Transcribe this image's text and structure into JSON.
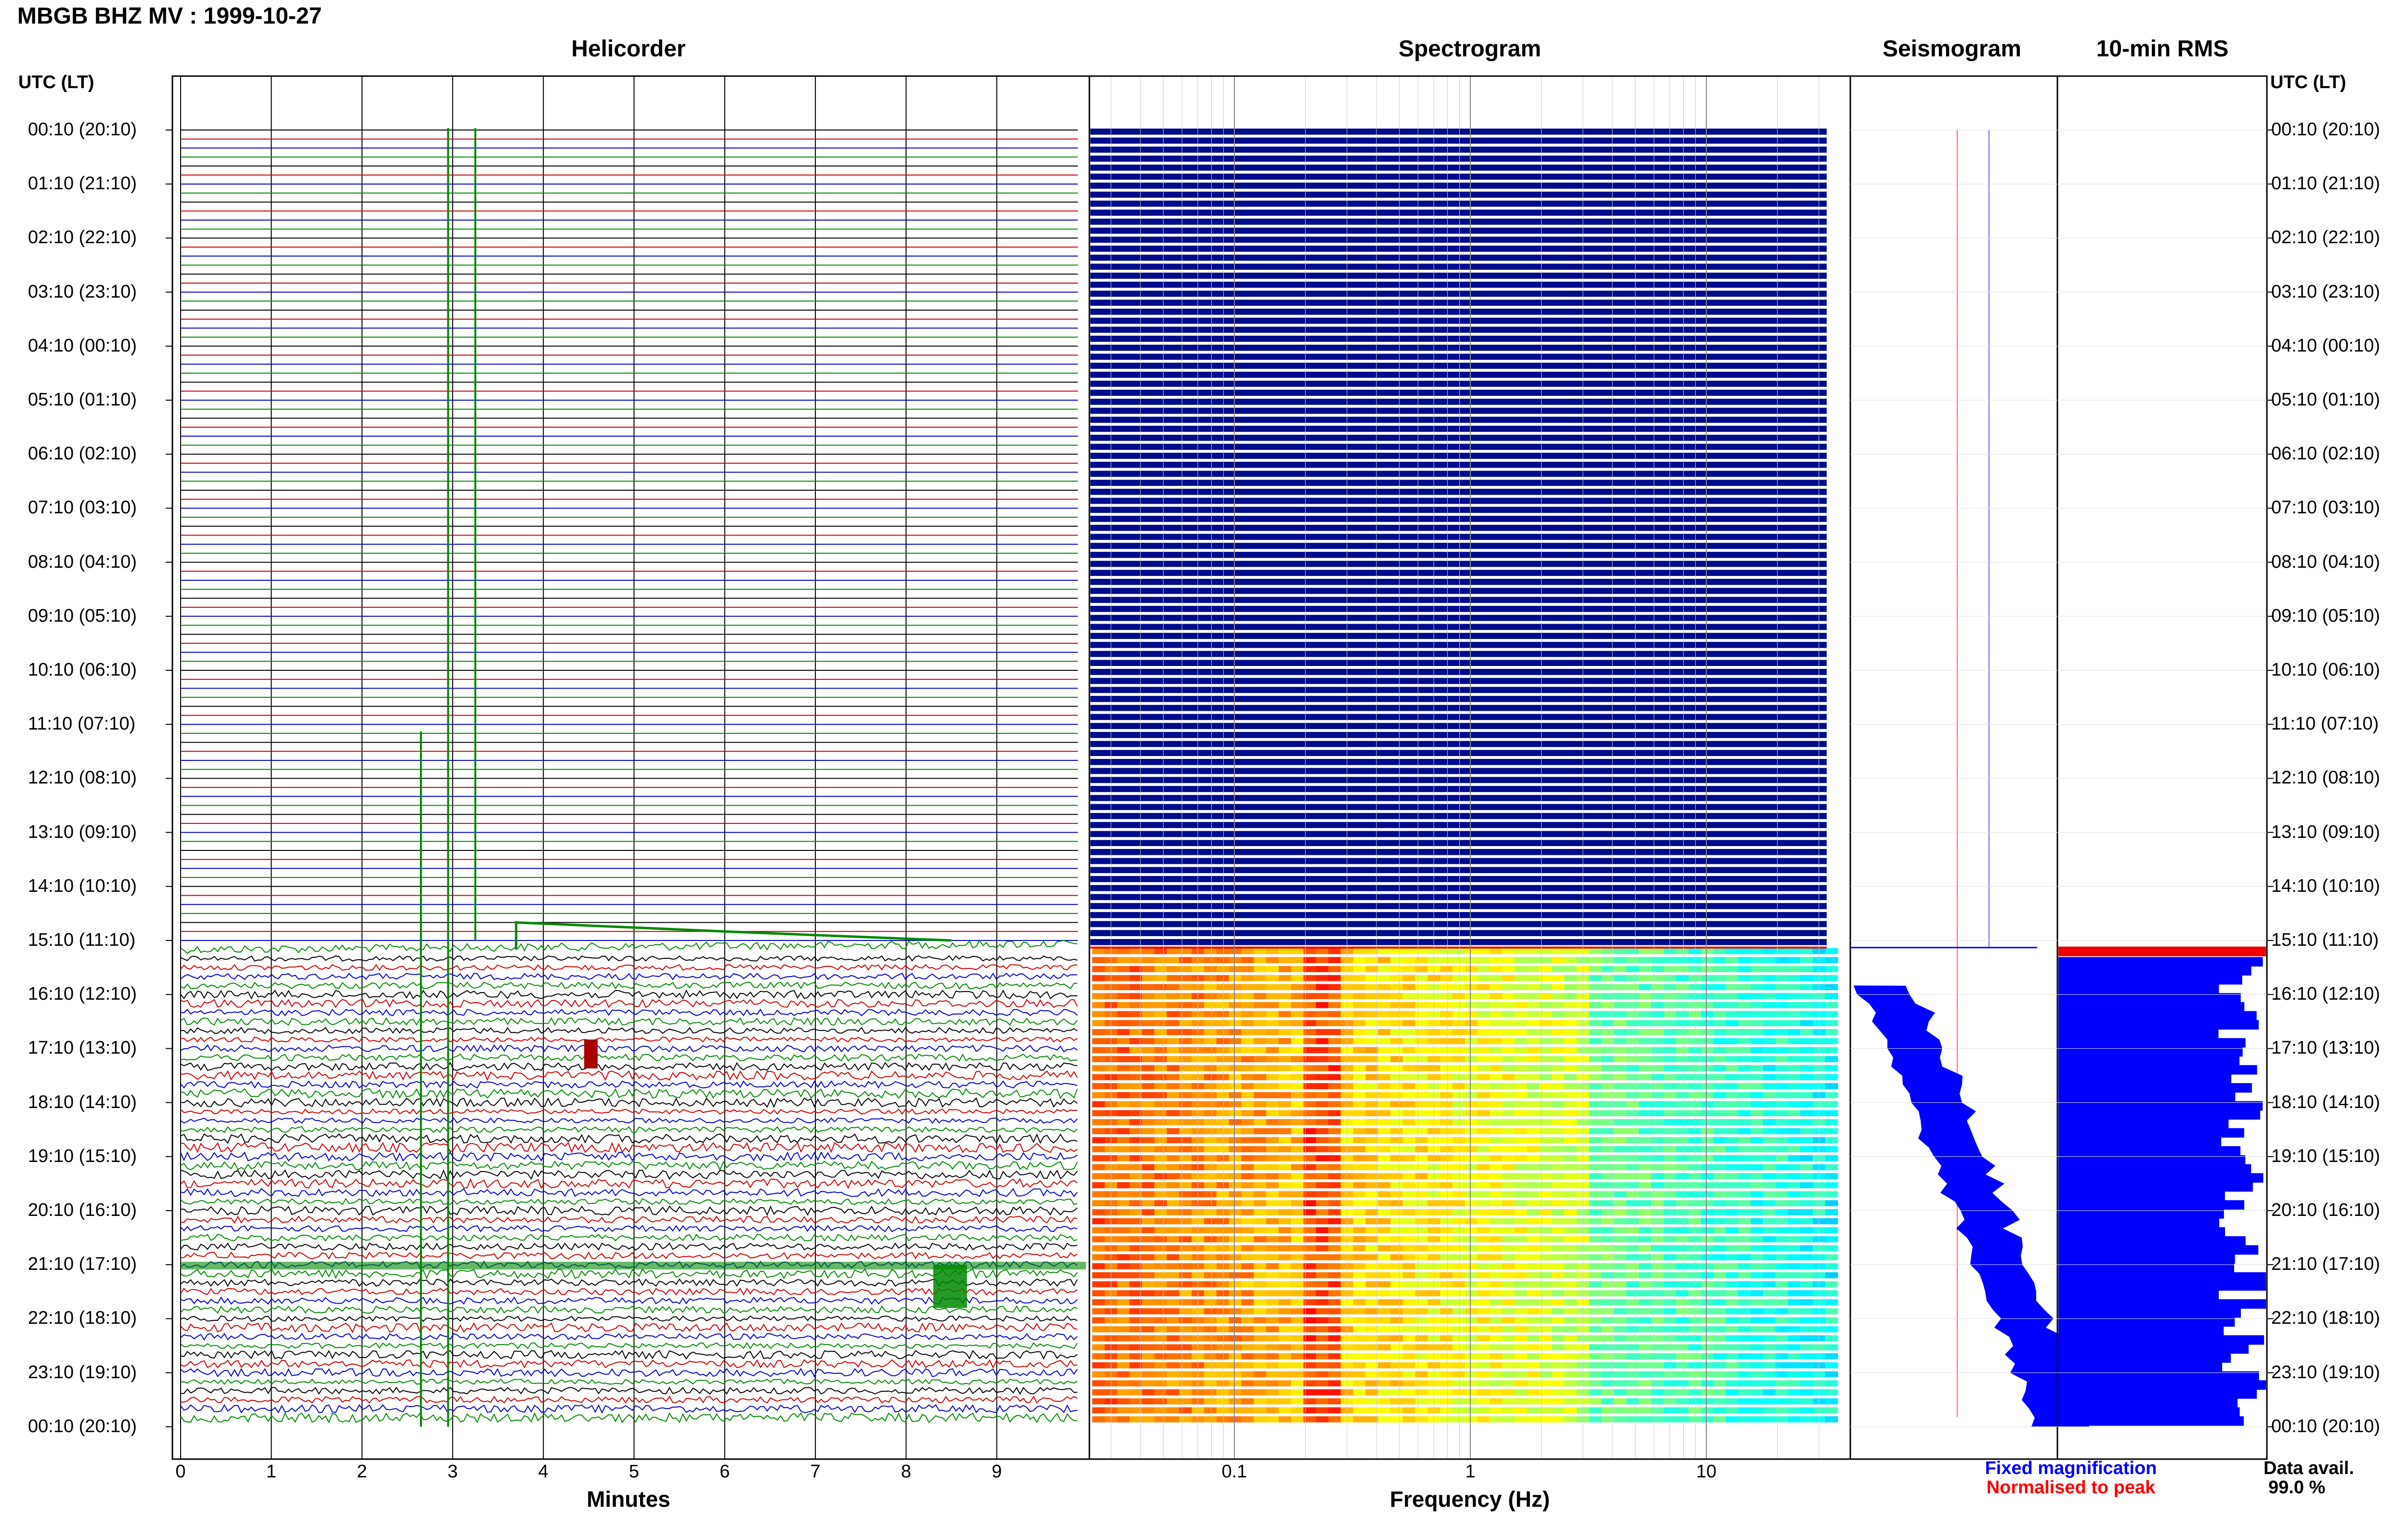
{
  "figure": {
    "title": "MBGB BHZ MV : 1999-10-27",
    "data_availability_label": "Data avail.",
    "data_availability_value": "99.0 %"
  },
  "panels": {
    "helicorder": {
      "title": "Helicorder",
      "xlabel": "Minutes"
    },
    "spectrogram": {
      "title": "Spectrogram",
      "xlabel": "Frequency (Hz)"
    },
    "seismogram": {
      "title": "Seismogram",
      "legend_fixed": "Fixed magnification",
      "legend_normalised": "Normalised to peak"
    },
    "rms": {
      "title": "10-min RMS"
    }
  },
  "time_axis": {
    "header": "UTC (LT)",
    "labels": [
      "00:10 (20:10)",
      "01:10 (21:10)",
      "02:10 (22:10)",
      "03:10 (23:10)",
      "04:10 (00:10)",
      "05:10 (01:10)",
      "06:10 (02:10)",
      "07:10 (03:10)",
      "08:10 (04:10)",
      "09:10 (05:10)",
      "10:10 (06:10)",
      "11:10 (07:10)",
      "12:10 (08:10)",
      "13:10 (09:10)",
      "14:10 (10:10)",
      "15:10 (11:10)",
      "16:10 (12:10)",
      "17:10 (13:10)",
      "18:10 (14:10)",
      "19:10 (15:10)",
      "20:10 (16:10)",
      "21:10 (17:10)",
      "22:10 (18:10)",
      "23:10 (19:10)",
      "00:10 (20:10)"
    ]
  },
  "colors": {
    "trace_cycle": [
      "#000000",
      "#cc0000",
      "#0000cc",
      "#008800"
    ],
    "spectrogram_empty": "#000c8c",
    "seismogram_fill": "#0000ff",
    "rms_fill": "#0000ff",
    "rms_top_band": "#ee0000",
    "legend_fixed": "#0000ff",
    "legend_normalised": "#ff0000"
  },
  "chart_data": [
    {
      "type": "line",
      "title": "Helicorder",
      "xlabel": "Minutes",
      "x_ticks": [
        0,
        1,
        2,
        3,
        4,
        5,
        6,
        7,
        8,
        9
      ],
      "xlim": [
        0,
        10
      ],
      "rows_per_hour": 6,
      "total_rows": 144,
      "data_start_row": 91,
      "flat_rows": "rows 0-90 show flat lines (no data)",
      "spike_events": [
        {
          "minute": 2.65,
          "row_range": [
            67,
            144
          ],
          "color": "green"
        },
        {
          "minute": 2.95,
          "row_range": [
            0,
            144
          ],
          "color": "green"
        },
        {
          "minute": 3.25,
          "row_range": [
            0,
            90
          ],
          "color": "green"
        }
      ]
    },
    {
      "type": "heatmap",
      "title": "Spectrogram",
      "xlabel": "Frequency (Hz)",
      "x_scale": "log",
      "x_ticks": [
        0.1,
        1,
        10
      ],
      "xlim": [
        0.025,
        40
      ],
      "colormap": "jet",
      "no_data_rows": [
        0,
        90
      ]
    },
    {
      "type": "area",
      "title": "Seismogram",
      "legend": [
        "Fixed magnification",
        "Normalised to peak"
      ],
      "note": "amplitude profile present only from 15:10 UTC onward"
    },
    {
      "type": "bar",
      "title": "10-min RMS",
      "orientation": "horizontal",
      "note": "bars present only from 15:10 UTC onward; top bar red"
    }
  ]
}
